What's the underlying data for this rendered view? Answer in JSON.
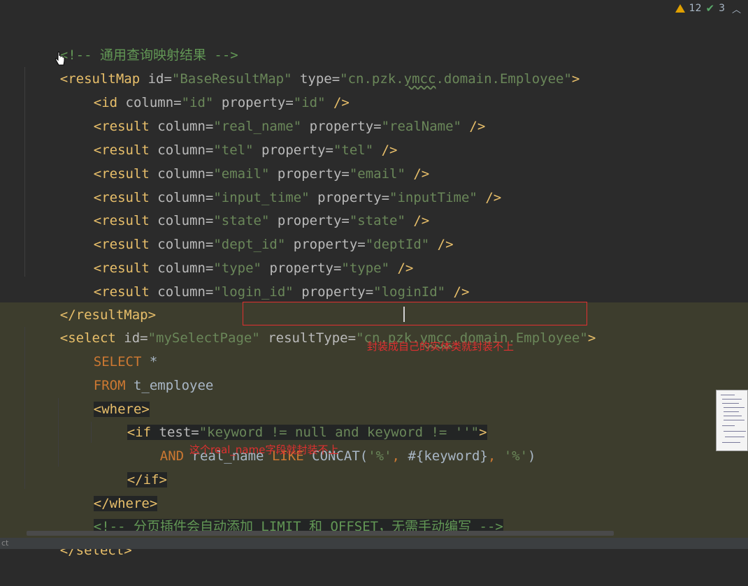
{
  "inspection": {
    "warnings": "12",
    "checks": "3"
  },
  "code": {
    "l1_comment": "<!-- 通用查询映射结果 -->",
    "l2": {
      "open": "<resultMap",
      "id_attr": " id=",
      "id_val": "\"BaseResultMap\"",
      "type_attr": " type=",
      "type_val_a": "\"cn.pzk.",
      "type_val_b": "ymcc",
      "type_val_c": ".domain.Employee\"",
      "close": ">"
    },
    "l3": {
      "open": "<id",
      "col_attr": " column=",
      "col_val": "\"id\"",
      "prop_attr": " property=",
      "prop_val": "\"id\"",
      "close": " />"
    },
    "results": [
      {
        "col": "\"real_name\"",
        "prop": "\"realName\""
      },
      {
        "col": "\"tel\"",
        "prop": "\"tel\""
      },
      {
        "col": "\"email\"",
        "prop": "\"email\""
      },
      {
        "col": "\"input_time\"",
        "prop": "\"inputTime\""
      },
      {
        "col": "\"state\"",
        "prop": "\"state\""
      },
      {
        "col": "\"dept_id\"",
        "prop": "\"deptId\""
      },
      {
        "col": "\"type\"",
        "prop": "\"type\""
      },
      {
        "col": "\"login_id\"",
        "prop": "\"loginId\""
      }
    ],
    "result_open": "<result",
    "column_attr": " column=",
    "property_attr": " property=",
    "self_close": " />",
    "resultmap_close": "</resultMap>",
    "select": {
      "open": "<select",
      "id_attr": " id=",
      "id_val": "\"mySelectPage\"",
      "rt_attr": "resultType=",
      "rt_val_a": "\"cn.pzk.",
      "rt_val_b": "ymcc",
      "rt_val_c": ".domain.Employee\"",
      "close": ">"
    },
    "sql_select": "SELECT",
    "sql_star": " *",
    "sql_from": "FROM",
    "sql_table": " t_employee",
    "where_open": "<where>",
    "if": {
      "open": "<if",
      "test_attr": " test=",
      "test_val": "\"keyword != null and keyword != ''\"",
      "close": ">"
    },
    "and_line": {
      "and": "AND",
      "col": " real_name ",
      "like": "LIKE",
      "fn": " CONCAT(",
      "s1": "'%'",
      "c1": ", ",
      "param": "#{keyword}",
      "c2": ", ",
      "s2": "'%'",
      "end": ")"
    },
    "if_close": "</if>",
    "where_close": "</where>",
    "page_comment": "<!-- 分页插件会自动添加 LIMIT 和 OFFSET，无需手动编写 -->",
    "select_close": "</select>"
  },
  "annotations": {
    "note1": "封装成自己的实体类就封装不上",
    "note2": "这个real_name字段就封装不上"
  },
  "status": {
    "left_text": "ct"
  },
  "colors": {
    "annotation_red": "#e03030",
    "string_green": "#6a8759",
    "tag_yellow": "#e8bf6a",
    "keyword_orange": "#cc7832"
  }
}
